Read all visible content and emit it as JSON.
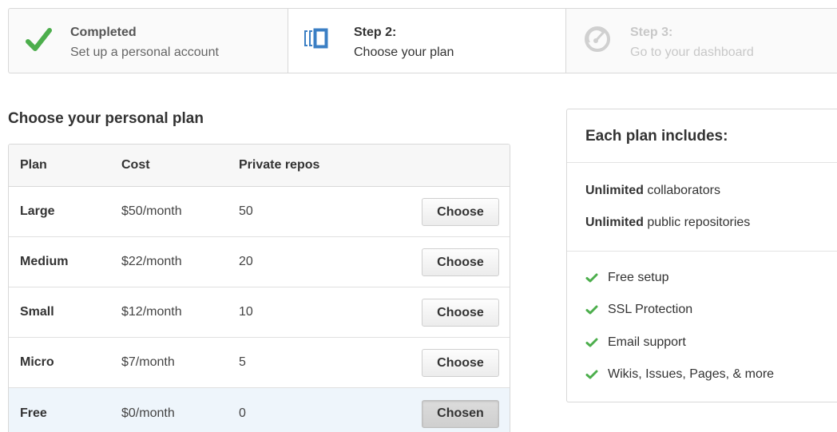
{
  "steps": [
    {
      "title": "Completed",
      "description": "Set up a personal account",
      "icon": "check-icon",
      "state": "completed"
    },
    {
      "title": "Step 2:",
      "description": "Choose your plan",
      "icon": "plan-icon",
      "state": "current"
    },
    {
      "title": "Step 3:",
      "description": "Go to your dashboard",
      "icon": "dashboard-gauge-icon",
      "state": "upcoming"
    }
  ],
  "page_heading": "Choose your personal plan",
  "plans_table": {
    "headers": {
      "plan": "Plan",
      "cost": "Cost",
      "repos": "Private repos"
    },
    "rows": [
      {
        "plan": "Large",
        "cost": "$50/month",
        "repos": "50",
        "button": "Choose"
      },
      {
        "plan": "Medium",
        "cost": "$22/month",
        "repos": "20",
        "button": "Choose"
      },
      {
        "plan": "Small",
        "cost": "$12/month",
        "repos": "10",
        "button": "Choose"
      },
      {
        "plan": "Micro",
        "cost": "$7/month",
        "repos": "5",
        "button": "Choose"
      },
      {
        "plan": "Free",
        "cost": "$0/month",
        "repos": "0",
        "button": "Chosen"
      }
    ]
  },
  "includes": {
    "heading": "Each plan includes:",
    "unlimited": [
      {
        "strong": "Unlimited",
        "text": " collaborators"
      },
      {
        "strong": "Unlimited",
        "text": " public repositories"
      }
    ],
    "features": [
      "Free setup",
      "SSL Protection",
      "Email support",
      "Wikis, Issues, Pages, & more"
    ]
  },
  "colors": {
    "check_green": "#4cae4c",
    "current_step_blue": "#3b7fc4",
    "chosen_row_bg": "#eef5fb",
    "muted_text": "#c8c8c8"
  }
}
